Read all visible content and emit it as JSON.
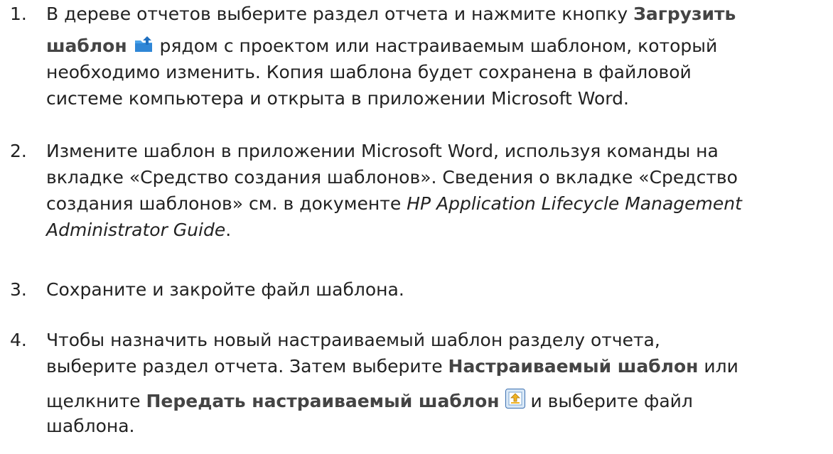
{
  "steps": [
    {
      "number": "1.",
      "text": {
        "a": "В дереве отчетов выберите раздел отчета и нажмите кнопку ",
        "b_bold": "Загрузить",
        "c_bold": "шаблон",
        "d": " рядом с проектом или настраиваемым шаблоном, который",
        "e": "необходимо изменить. Копия шаблона будет сохранена в файловой",
        "f": "системе компьютера и открыта в приложении Microsoft Word."
      },
      "icon": "download-template-icon"
    },
    {
      "number": "2.",
      "text": {
        "a": "Измените шаблон в приложении Microsoft Word, используя команды на",
        "b": "вкладке «Средство создания шаблонов». Сведения о вкладке «Средство",
        "c": "создания шаблонов» см. в документе ",
        "c_italic": "HP Application Lifecycle Management",
        "d_italic": "Administrator Guide",
        "d_end": "."
      }
    },
    {
      "number": "3.",
      "text": {
        "a": "Сохраните и закройте файл шаблона."
      }
    },
    {
      "number": "4.",
      "text": {
        "a": "Чтобы назначить новый настраиваемый шаблон разделу отчета,",
        "b": "выберите раздел отчета. Затем выберите ",
        "b_bold": "Настраиваемый шаблон",
        "b_end": " или",
        "c": "щелкните ",
        "c_bold": "Передать настраиваемый шаблон",
        "c_end": " и выберите файл",
        "d": "шаблона."
      },
      "icon": "upload-template-icon"
    }
  ],
  "colors": {
    "text": "#222222",
    "bold": "#444444",
    "icon_blue": "#2f86d6",
    "icon_frame": "#3a6fb0"
  }
}
